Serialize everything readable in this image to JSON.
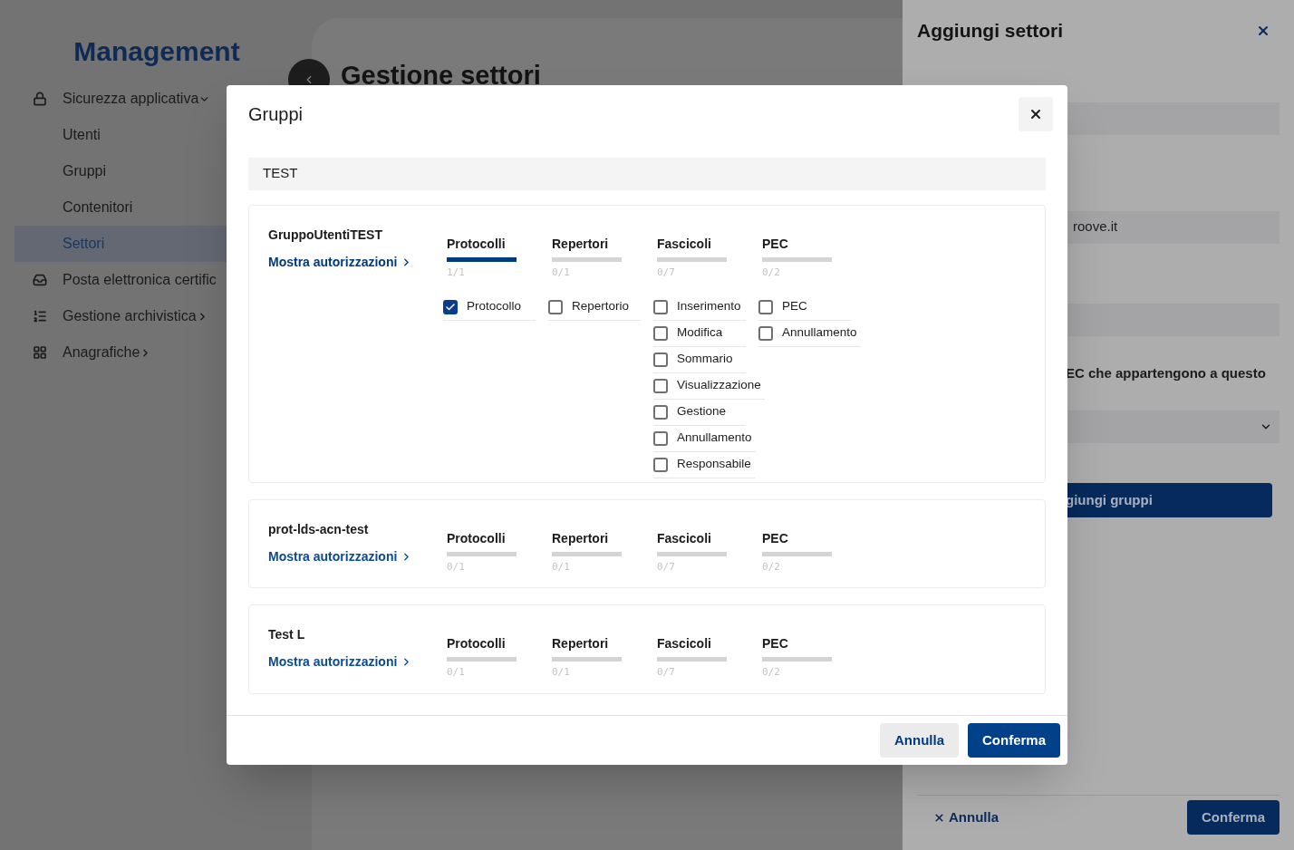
{
  "sidebar": {
    "title": "Management",
    "items": [
      {
        "label": "Sicurezza applicativa",
        "expanded": true,
        "selected": false,
        "children": [
          {
            "label": "Utenti",
            "selected": false
          },
          {
            "label": "Gruppi",
            "selected": false
          },
          {
            "label": "Contenitori",
            "selected": false
          },
          {
            "label": "Settori",
            "selected": true
          }
        ]
      },
      {
        "label": "Posta elettronica certific",
        "selected": false
      },
      {
        "label": "Gestione archivistica",
        "expanded": false,
        "selected": false
      },
      {
        "label": "Anagrafiche",
        "expanded": false,
        "selected": false
      }
    ]
  },
  "page": {
    "title": "Gestione settori"
  },
  "drawer": {
    "title": "Aggiungi settori",
    "fields": [
      {
        "kind": "input"
      },
      {
        "kind": "input",
        "value": "roove.it"
      },
      {
        "kind": "input"
      },
      {
        "kind": "text",
        "value": "EC che appartengono a questo"
      },
      {
        "kind": "select"
      },
      {
        "kind": "button",
        "value": "giungi gruppi"
      }
    ],
    "cancel": "Annulla",
    "confirm": "Conferma"
  },
  "modal": {
    "title": "Gruppi",
    "search": {
      "value": "TEST"
    },
    "groups": [
      {
        "name": "GruppoUtentiTEST",
        "link": "Mostra autorizzazioni",
        "expanded": true,
        "categories": [
          {
            "label": "Protocolli",
            "level": 1,
            "count": "1/1",
            "permissions": [
              {
                "label": "Protocollo",
                "checked": true
              }
            ]
          },
          {
            "label": "Repertori",
            "level": 0,
            "count": "0/1",
            "permissions": [
              {
                "label": "Repertorio",
                "checked": false
              }
            ]
          },
          {
            "label": "Fascicoli",
            "level": 0,
            "count": "0/7",
            "permissions": [
              {
                "label": "Inserimento",
                "checked": false
              },
              {
                "label": "Modifica",
                "checked": false
              },
              {
                "label": "Sommario",
                "checked": false
              },
              {
                "label": "Visualizzazione",
                "checked": false
              },
              {
                "label": "Gestione",
                "checked": false
              },
              {
                "label": "Annullamento",
                "checked": false
              },
              {
                "label": "Responsabile",
                "checked": false
              }
            ]
          },
          {
            "label": "PEC",
            "level": 0,
            "count": "0/2",
            "permissions": [
              {
                "label": "PEC",
                "checked": false
              },
              {
                "label": "Annullamento",
                "checked": false
              }
            ]
          }
        ]
      },
      {
        "name": "prot-lds-acn-test",
        "link": "Mostra autorizzazioni",
        "expanded": false,
        "categories": [
          {
            "label": "Protocolli",
            "level": 0,
            "count": "0/1"
          },
          {
            "label": "Repertori",
            "level": 0,
            "count": "0/1"
          },
          {
            "label": "Fascicoli",
            "level": 0,
            "count": "0/7"
          },
          {
            "label": "PEC",
            "level": 0,
            "count": "0/2"
          }
        ]
      },
      {
        "name": "Test L",
        "link": "Mostra autorizzazioni",
        "expanded": false,
        "categories": [
          {
            "label": "Protocolli",
            "level": 0,
            "count": "0/1"
          },
          {
            "label": "Repertori",
            "level": 0,
            "count": "0/1"
          },
          {
            "label": "Fascicoli",
            "level": 0,
            "count": "0/7"
          },
          {
            "label": "PEC",
            "level": 0,
            "count": "0/2"
          }
        ]
      }
    ],
    "cancel": "Annulla",
    "confirm": "Conferma"
  }
}
